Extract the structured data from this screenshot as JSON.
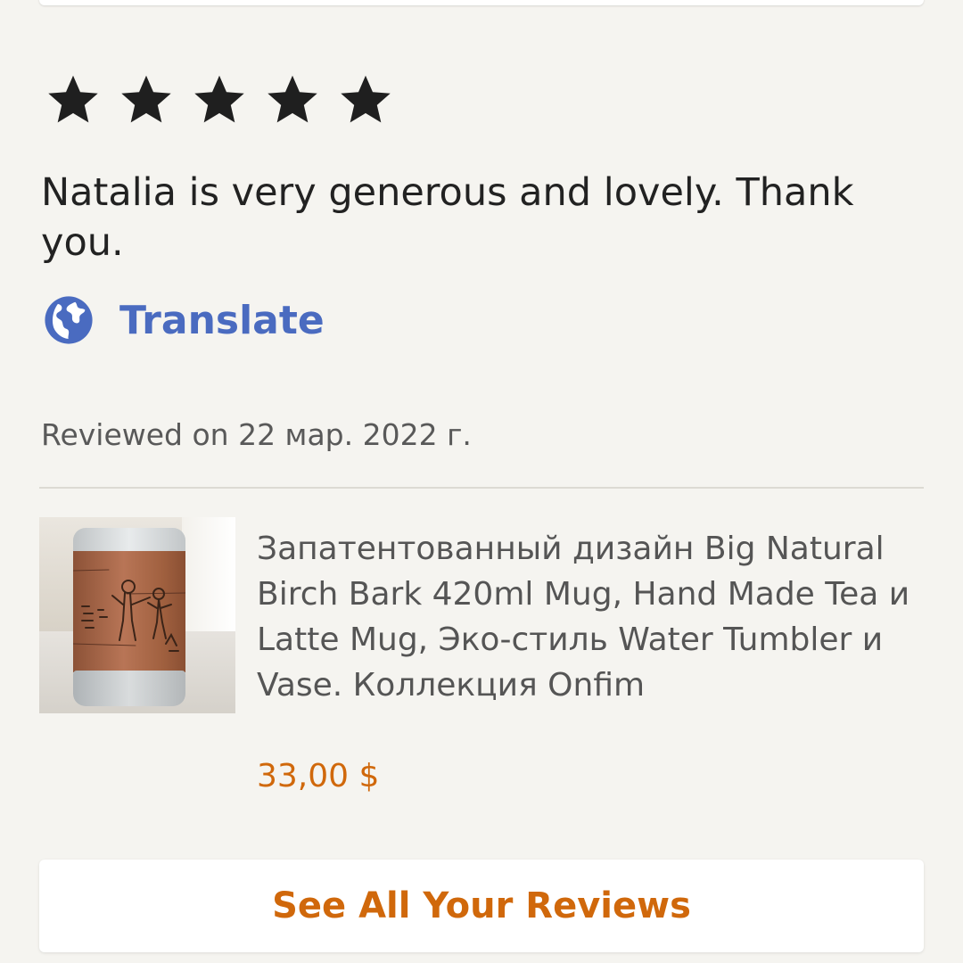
{
  "review": {
    "rating": 5,
    "rating_max": 5,
    "star_icon": "star-icon",
    "text": "Natalia is very generous and lovely. Thank you.",
    "translate_icon": "globe-icon",
    "translate_label": "Translate",
    "reviewed_on": "Reviewed on 22 мар. 2022 г."
  },
  "listing": {
    "image_subject": "birch-bark-mug-photo",
    "title": "Запатентованный дизайн Big Natural Birch Bark 420ml Mug, Hand Made Tea и Latte Mug, Эко-стиль Water Tumbler и Vase. Коллекция Onfim",
    "price": "33,00 $"
  },
  "actions": {
    "see_all_label": "See All Your Reviews"
  },
  "colors": {
    "background": "#f5f4f0",
    "text": "#222222",
    "link_blue": "#4a6bc0",
    "accent_orange": "#d0680b",
    "muted": "#595959"
  }
}
